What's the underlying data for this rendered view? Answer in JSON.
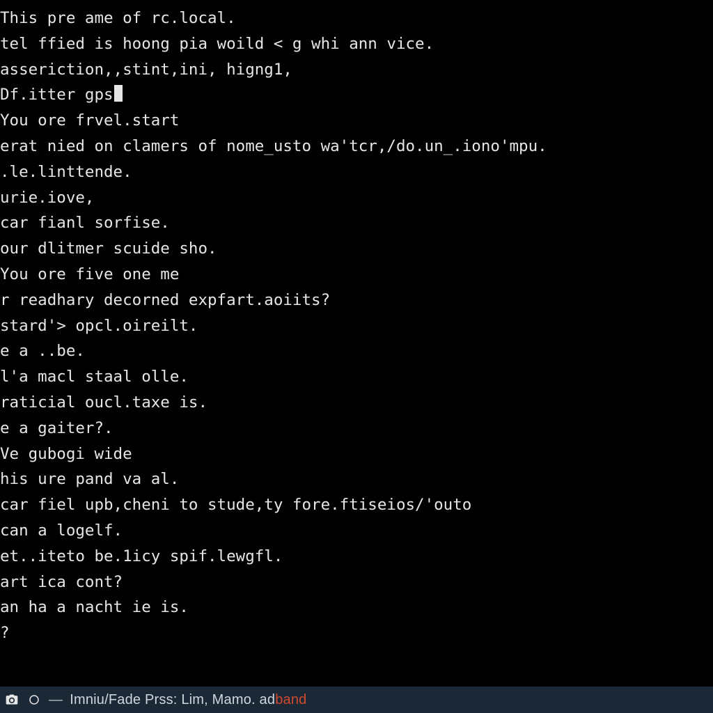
{
  "terminal": {
    "lines": [
      "This pre ame of rc.local.",
      "tel ffied is hoong pia woild < g whi ann vice.",
      "asseriction,,stint,ini, higng1,",
      "Df.itter gps",
      "",
      "You ore frvel.start",
      "erat nied on clamers of nome_usto wa'tcr,/do.un_.iono'mpu.",
      ".le.linttende.",
      "urie.iove,",
      "car fianl sorfise.",
      "our dlitmer scuide sho.",
      "",
      "You ore five one me",
      "r readhary decorned expfart.aoiits?",
      "stard'> opcl.oireilt.",
      "e a ..be.",
      "l'a macl staal olle.",
      "raticial oucl.taxe is.",
      "e a gaiter?.",
      "Ve gubogi wide",
      "his ure pand va al.",
      "car fiel upb,cheni to stude,ty fore.ftiseios/'outo",
      "can a logelf.",
      "et..iteto be.1icy spif.lewgfl.",
      "art ica cont?",
      "an ha a nacht ie is.",
      "?"
    ],
    "cursor_line_index": 3
  },
  "statusbar": {
    "icons": [
      "camera-icon",
      "circle-icon"
    ],
    "separator": "—",
    "label_prefix": "Imniu/Fade Prss: Lim, Mamo. ad",
    "label_accent": "band"
  }
}
